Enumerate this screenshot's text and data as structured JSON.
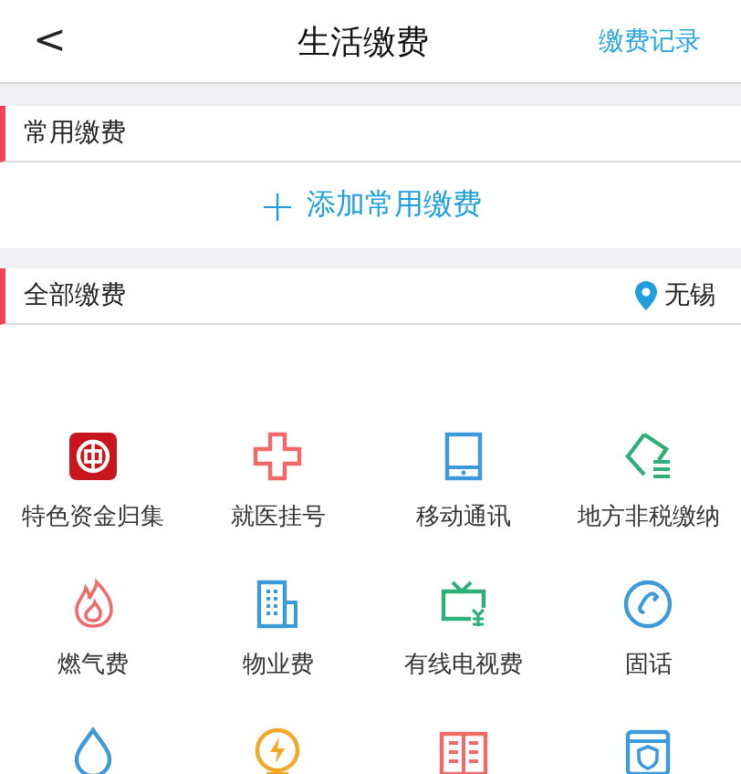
{
  "header": {
    "back": "<",
    "title": "生活缴费",
    "action": "缴费记录"
  },
  "frequent": {
    "title": "常用缴费",
    "add_icon": "+",
    "add_label": "添加常用缴费"
  },
  "all": {
    "title": "全部缴费",
    "city": "无锡"
  },
  "services": [
    {
      "kind": "bank",
      "label": "特色资金归集"
    },
    {
      "kind": "medical",
      "label": "就医挂号"
    },
    {
      "kind": "mobile",
      "label": "移动通讯"
    },
    {
      "kind": "ticket",
      "label": "地方非税缴纳"
    },
    {
      "kind": "flame",
      "label": "燃气费"
    },
    {
      "kind": "building",
      "label": "物业费"
    },
    {
      "kind": "tv",
      "label": "有线电视费"
    },
    {
      "kind": "phone",
      "label": "固话"
    },
    {
      "kind": "water"
    },
    {
      "kind": "power"
    },
    {
      "kind": "book"
    },
    {
      "kind": "shield"
    }
  ]
}
